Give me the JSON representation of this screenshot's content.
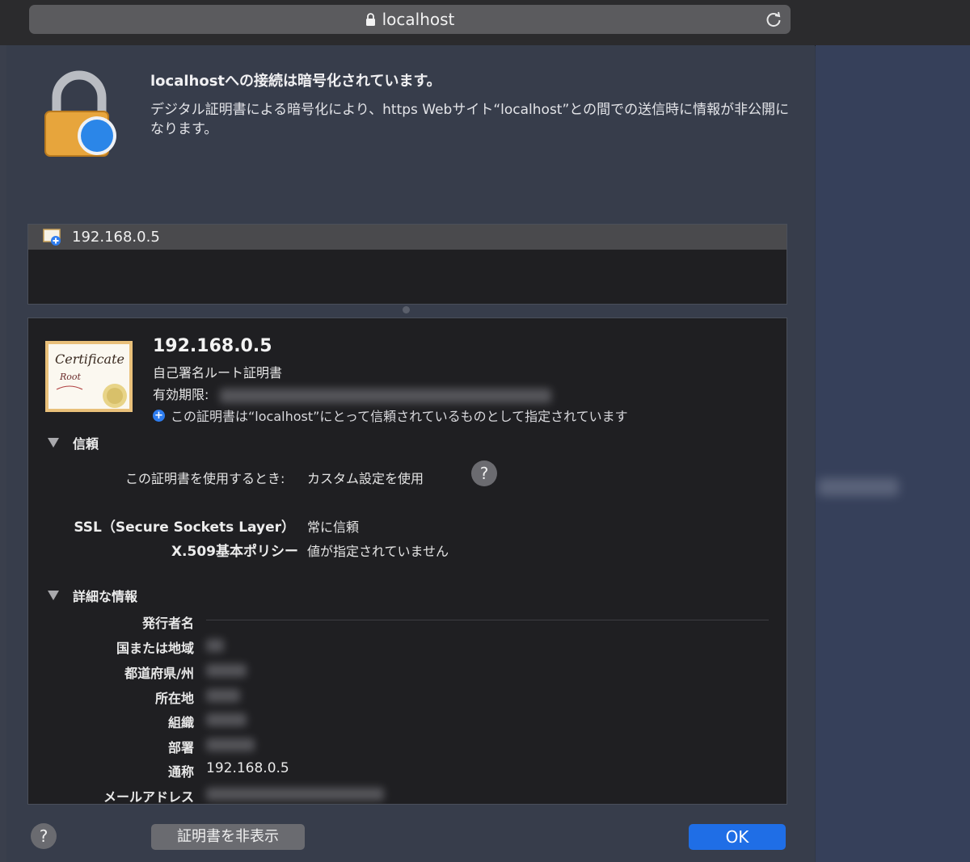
{
  "browser": {
    "url_text": "localhost"
  },
  "header": {
    "title": "localhostへの接続は暗号化されています。",
    "description": "デジタル証明書による暗号化により、https Webサイト“localhost”との間での送信時に情報が非公開になります。"
  },
  "cert_list": {
    "items": [
      {
        "label": "192.168.0.5"
      }
    ]
  },
  "cert_detail": {
    "common_name": "192.168.0.5",
    "kind": "自己署名ルート証明書",
    "expires_label": "有効期限:",
    "trust_note": "この証明書は“localhost”にとって信頼されているものとして指定されています",
    "badge_text": [
      "Certificate",
      "Root"
    ]
  },
  "trust": {
    "heading": "信頼",
    "usage_label": "この証明書を使用するとき:",
    "usage_value": "カスタム設定を使用",
    "rows": [
      {
        "label": "SSL（Secure Sockets Layer）",
        "value": "常に信頼"
      },
      {
        "label": "X.509基本ポリシー",
        "value": "値が指定されていません"
      }
    ]
  },
  "details": {
    "heading": "詳細な情報",
    "issuer_label": "発行者名",
    "rows": [
      {
        "label": "国または地域",
        "value": ""
      },
      {
        "label": "都道府県/州",
        "value": ""
      },
      {
        "label": "所在地",
        "value": ""
      },
      {
        "label": "組織",
        "value": ""
      },
      {
        "label": "部署",
        "value": ""
      },
      {
        "label": "通称",
        "value": "192.168.0.5"
      },
      {
        "label": "メールアドレス",
        "value": ""
      }
    ]
  },
  "buttons": {
    "help": "?",
    "hide_cert": "証明書を非表示",
    "ok": "OK"
  },
  "colors": {
    "accent": "#1f6ee6",
    "sheet_bg": "#373d4b",
    "panel_bg": "#1f1f22"
  }
}
